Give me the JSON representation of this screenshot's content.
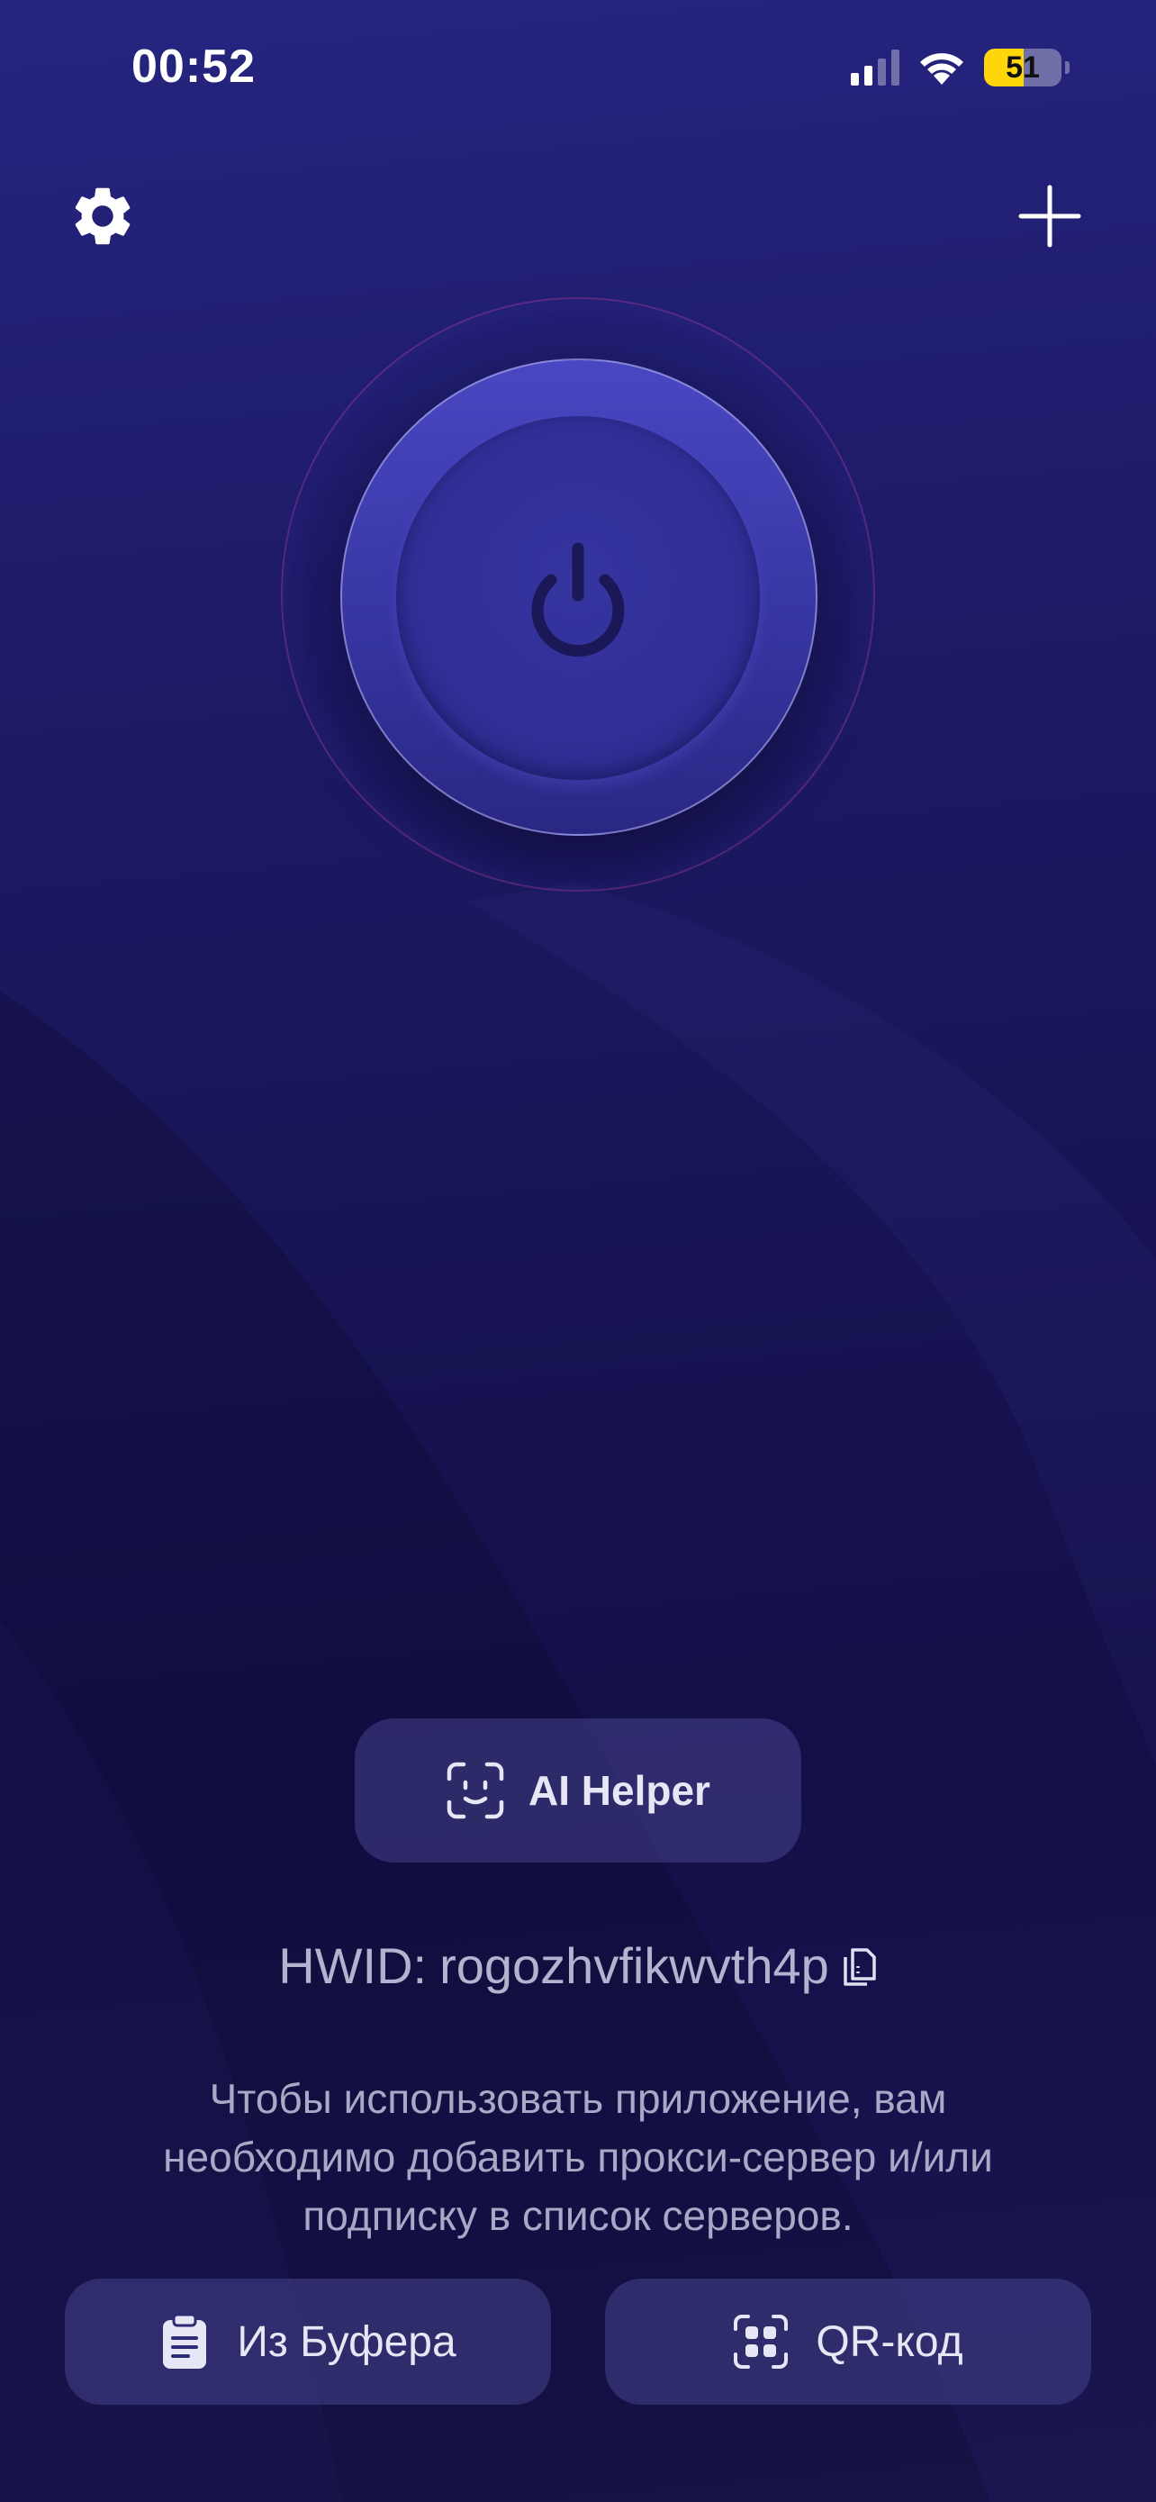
{
  "status_bar": {
    "time": "00:52",
    "battery_level": "51",
    "battery_fraction": 0.51,
    "battery_color": "#ffd60a",
    "signal_bars_active": 2,
    "signal_bars_total": 4
  },
  "header": {
    "settings_icon": "gear-icon",
    "add_icon": "plus-icon"
  },
  "power": {
    "icon": "power-icon",
    "state": "disconnected"
  },
  "ai_helper": {
    "icon": "face-scan-icon",
    "label": "AI Helper"
  },
  "hwid": {
    "label": "HWID:",
    "value": "rogozhvfikwvth4p",
    "copy_icon": "copy-icon"
  },
  "info": {
    "text": "Чтобы использовать приложение, вам необходимо добавить прокси-сервер и/или подписку в список серверов."
  },
  "actions": {
    "clipboard": {
      "icon": "clipboard-icon",
      "label": "Из Буфера"
    },
    "qr": {
      "icon": "qr-scan-icon",
      "label": "QR-код"
    }
  },
  "colors": {
    "background": "#1a1658",
    "button_surface": "#3a3880",
    "power_accent": "#4a47c2",
    "text_muted": "#b4b3cf"
  }
}
